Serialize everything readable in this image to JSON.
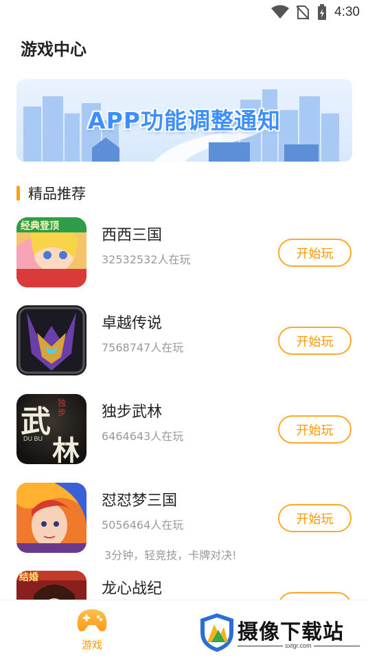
{
  "status_bar": {
    "time": "4:30"
  },
  "header": {
    "title": "游戏中心"
  },
  "banner": {
    "title": "APP功能调整通知"
  },
  "section": {
    "title": "精品推荐"
  },
  "games": [
    {
      "name": "西西三国",
      "players": "32532532人在玩",
      "button": "开始玩",
      "desc": ""
    },
    {
      "name": "卓越传说",
      "players": "7568747人在玩",
      "button": "开始玩",
      "desc": ""
    },
    {
      "name": "独步武林",
      "players": "6464643人在玩",
      "button": "开始玩",
      "desc": ""
    },
    {
      "name": "怼怼梦三国",
      "players": "5056464人在玩",
      "button": "开始玩",
      "desc": "3分钟，轻竞技，卡牌对决!"
    },
    {
      "name": "龙心战纪",
      "players": "",
      "button": "",
      "desc": ""
    }
  ],
  "icon_text": {
    "game1_badge": "经典登顶",
    "game3_main": "武",
    "game3_main2": "林",
    "game3_small": "独步",
    "game3_pinyin": "DU BU",
    "game5_badge": "结婚"
  },
  "tab_bar": {
    "games_label": "游戏"
  },
  "watermark": {
    "text": "摄像下载站",
    "sub": "sxtgr.com"
  },
  "colors": {
    "accent": "#ff9800",
    "banner_text": "#3d8fff"
  }
}
